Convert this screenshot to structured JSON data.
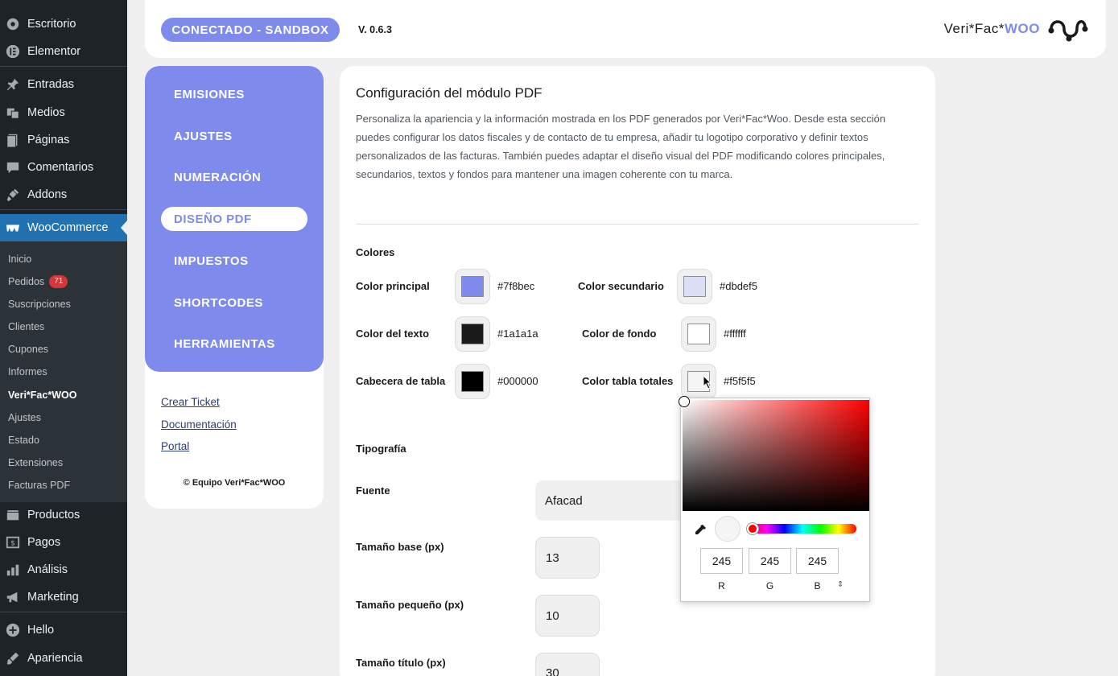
{
  "wp_menu": {
    "escritorio": "Escritorio",
    "elementor": "Elementor",
    "entradas": "Entradas",
    "medios": "Medios",
    "paginas": "Páginas",
    "comentarios": "Comentarios",
    "addons": "Addons",
    "woocommerce": "WooCommerce",
    "productos": "Productos",
    "pagos": "Pagos",
    "analisis": "Análisis",
    "marketing": "Marketing",
    "hello": "Hello",
    "apariencia": "Apariencia"
  },
  "woo_submenu": {
    "inicio": "Inicio",
    "pedidos": "Pedidos",
    "pedidos_badge": "71",
    "suscripciones": "Suscripciones",
    "clientes": "Clientes",
    "cupones": "Cupones",
    "informes": "Informes",
    "verifac": "Veri*Fac*WOO",
    "ajustes": "Ajustes",
    "estado": "Estado",
    "extensiones": "Extensiones",
    "facturas": "Facturas PDF"
  },
  "topbar": {
    "status": "CONECTADO - SANDBOX",
    "version": "V. 0.6.3",
    "brand_prefix": "Veri*Fac*",
    "brand_suffix": "WOO"
  },
  "plugin_nav": {
    "emisiones": "EMISIONES",
    "ajustes": "AJUSTES",
    "numeracion": "NUMERACIÓN",
    "diseno": "DISEÑO PDF",
    "impuestos": "IMPUESTOS",
    "shortcodes": "SHORTCODES",
    "herramientas": "HERRAMIENTAS"
  },
  "links": {
    "ticket": "Crear Ticket",
    "docs": "Documentación",
    "portal": "Portal",
    "copyright": "© Equipo Veri*Fac*WOO"
  },
  "main": {
    "title": "Configuración del módulo PDF",
    "description": "Personaliza la apariencia y la información mostrada en los PDF generados por Veri*Fac*Woo. Desde esta sección puedes configurar los datos fiscales y de contacto de tu empresa, añadir tu logotipo corporativo y definir textos personalizados de las facturas. También puedes adaptar el diseño visual del PDF modificando colores principales, secundarios, textos y fondos para mantener una imagen coherente con tu marca.",
    "colors_heading": "Colores",
    "colors": {
      "principal": {
        "label": "Color principal",
        "hex": "#7f8bec"
      },
      "secundario": {
        "label": "Color secundario",
        "hex": "#dbdef5"
      },
      "texto": {
        "label": "Color del texto",
        "hex": "#1a1a1a"
      },
      "fondo": {
        "label": "Color de fondo",
        "hex": "#ffffff"
      },
      "cabecera": {
        "label": "Cabecera de tabla",
        "hex": "#000000"
      },
      "totales": {
        "label": "Color tabla totales",
        "hex": "#f5f5f5"
      }
    },
    "typography_heading": "Tipografía",
    "font_label": "Fuente",
    "font_value": "Afacad",
    "base_label": "Tamaño base (px)",
    "base_value": "13",
    "small_label": "Tamaño pequeño (px)",
    "small_value": "10",
    "title_size_label": "Tamaño título (px)",
    "title_size_value": "30"
  },
  "picker": {
    "r": "245",
    "g": "245",
    "b": "245",
    "r_label": "R",
    "g_label": "G",
    "b_label": "B"
  }
}
